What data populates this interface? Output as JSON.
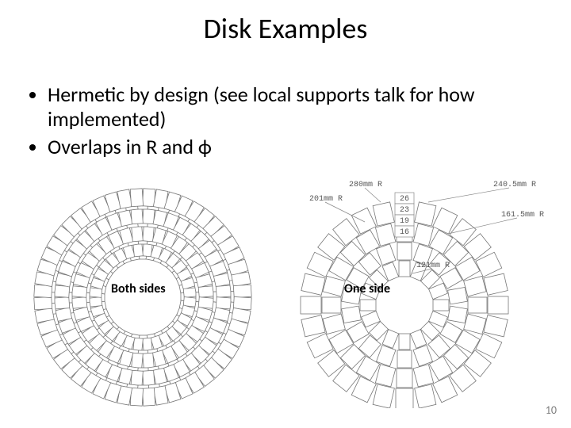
{
  "title": "Disk Examples",
  "bullets": [
    "Hermetic by design (see local supports talk for how implemented)",
    "Overlaps in R and ϕ"
  ],
  "figures": {
    "left": {
      "caption": "Both sides",
      "rings": [
        {
          "r": 58,
          "count": 32,
          "tw": 11,
          "th": 20
        },
        {
          "r": 78,
          "count": 36,
          "tw": 13,
          "th": 22
        },
        {
          "r": 100,
          "count": 44,
          "tw": 14,
          "th": 22
        },
        {
          "r": 122,
          "count": 52,
          "tw": 15,
          "th": 22
        }
      ]
    },
    "right": {
      "caption": "One side",
      "rings": [
        {
          "r": 46,
          "count": 16,
          "tw": 14,
          "th": 20
        },
        {
          "r": 68,
          "count": 18,
          "tw": 18,
          "th": 22
        },
        {
          "r": 92,
          "count": 24,
          "tw": 20,
          "th": 24
        },
        {
          "r": 118,
          "count": 28,
          "tw": 22,
          "th": 26
        }
      ],
      "callouts": {
        "radii": [
          "280mm R",
          "201mm R",
          "240.5mm R",
          "161.5mm R",
          "121mm R"
        ],
        "counts": [
          "26",
          "23",
          "19",
          "16"
        ]
      }
    }
  },
  "page_number": "10"
}
